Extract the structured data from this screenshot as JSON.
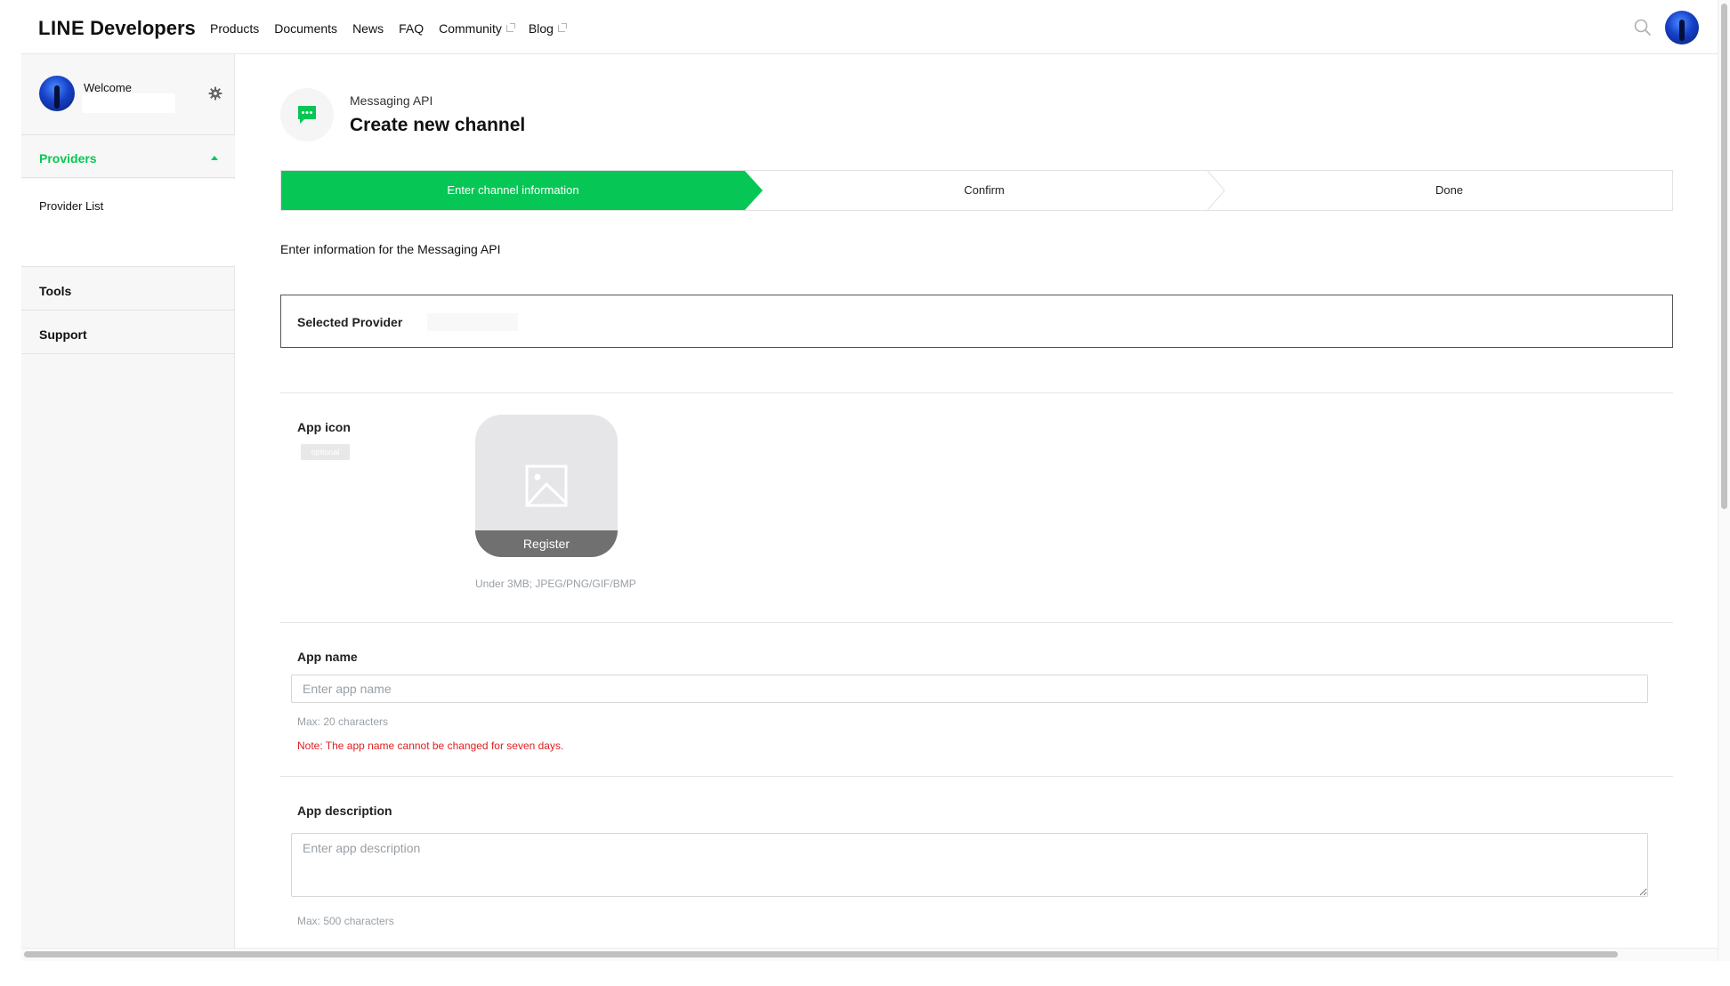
{
  "header": {
    "logo_bold": "LINE",
    "logo_regular": "Developers",
    "nav": [
      {
        "label": "Products",
        "external": false
      },
      {
        "label": "Documents",
        "external": false
      },
      {
        "label": "News",
        "external": false
      },
      {
        "label": "FAQ",
        "external": false
      },
      {
        "label": "Community",
        "external": true
      },
      {
        "label": "Blog",
        "external": true
      }
    ],
    "search_icon": "search-icon",
    "avatar_icon": "user-avatar"
  },
  "sidebar": {
    "welcome": "Welcome",
    "settings_icon": "gear-icon",
    "providers_label": "Providers",
    "provider_list_label": "Provider List",
    "tools_label": "Tools",
    "support_label": "Support"
  },
  "main": {
    "channel_type": "Messaging API",
    "page_title": "Create new channel",
    "steps": [
      {
        "label": "Enter channel information",
        "active": true
      },
      {
        "label": "Confirm",
        "active": false
      },
      {
        "label": "Done",
        "active": false
      }
    ],
    "intro": "Enter information for the Messaging API",
    "selected_provider_label": "Selected Provider",
    "app_icon": {
      "label": "App icon",
      "optional_badge": "optional",
      "register_label": "Register",
      "hint": "Under 3MB; JPEG/PNG/GIF/BMP"
    },
    "app_name": {
      "label": "App name",
      "value": "",
      "placeholder": "Enter app name",
      "hint": "Max: 20 characters",
      "note": "Note: The app name cannot be changed for seven days."
    },
    "app_description": {
      "label": "App description",
      "value": "",
      "placeholder": "Enter app description",
      "hint": "Max: 500 characters"
    }
  },
  "colors": {
    "brand_green": "#06c755",
    "note_red": "#e02020"
  }
}
